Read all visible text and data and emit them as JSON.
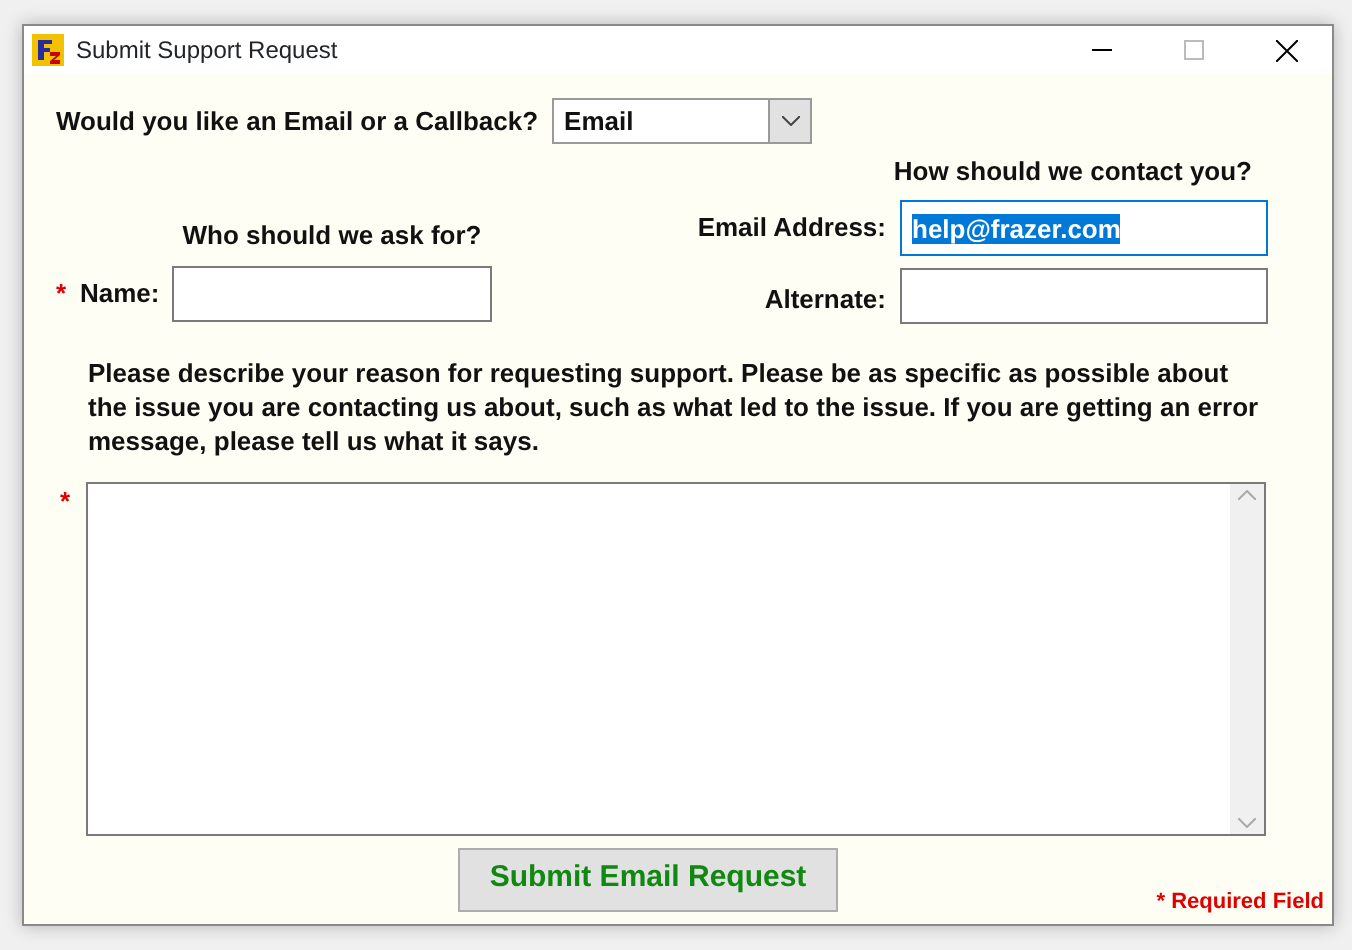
{
  "window": {
    "title": "Submit Support Request"
  },
  "contact_method": {
    "label": "Would you like an Email or a Callback?",
    "value": "Email"
  },
  "left_heading": "Who should we ask for?",
  "right_heading": "How should we contact you?",
  "name_field": {
    "label": "Name:",
    "required": true
  },
  "email_field": {
    "label": "Email Address:",
    "value": "help@frazer.com",
    "text_selected": true
  },
  "alternate_field": {
    "label": "Alternate:"
  },
  "instructions": "Please describe your reason for requesting support. Please be as specific as possible about the issue you are contacting us about, such as what led to the issue. If you are getting an error message, please tell us what it says.",
  "description_field": {
    "required": true
  },
  "submit_button": "Submit Email Request",
  "required_note": "* Required Field",
  "required_mark": "*"
}
